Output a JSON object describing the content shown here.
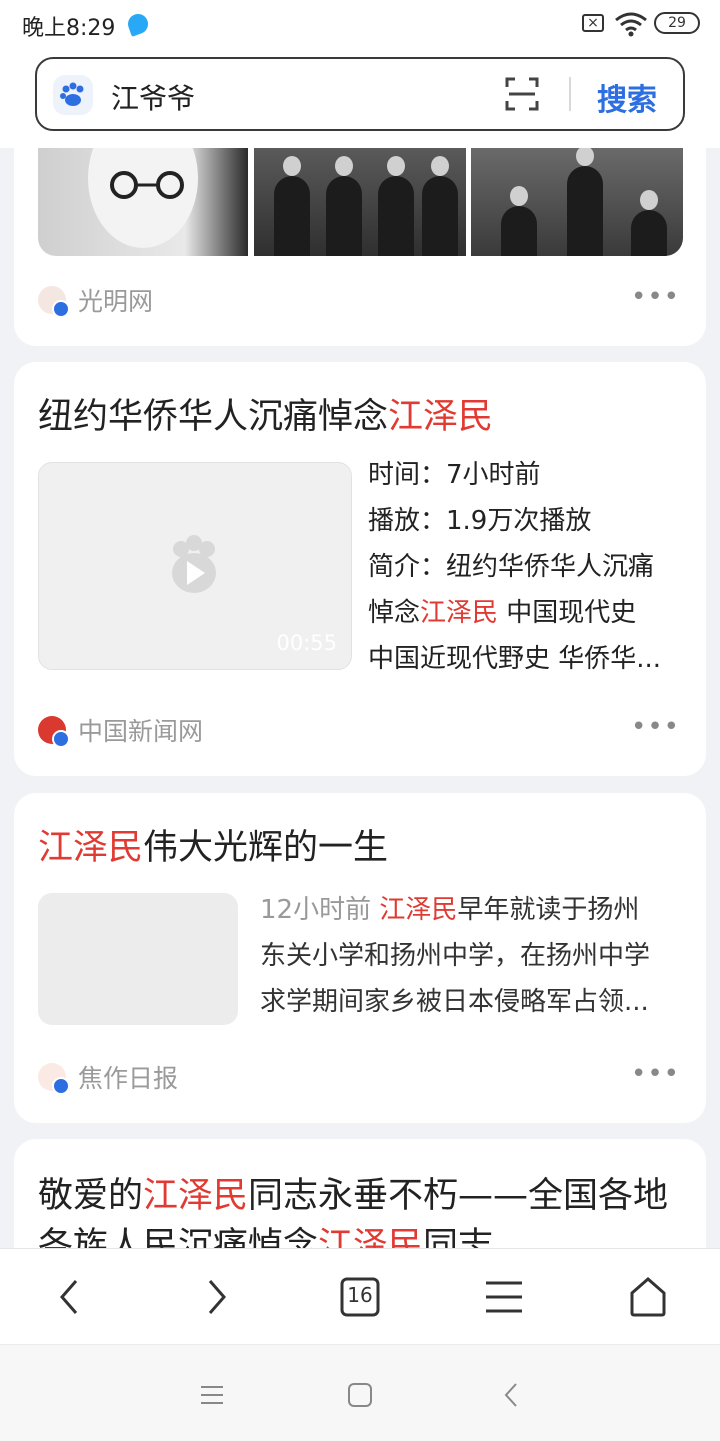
{
  "status_bar": {
    "time": "晚上8:29",
    "battery": "29"
  },
  "search": {
    "query": "江爷爷",
    "button_label": "搜索"
  },
  "cards": [
    {
      "source": "光明网"
    },
    {
      "title_prefix": "纽约华侨华人沉痛悼念",
      "title_highlight": "江泽民",
      "video_duration": "00:55",
      "time_line": "时间：7小时前",
      "plays_line": "播放：1.9万次播放",
      "intro_line1": "简介：纽约华侨华人沉痛",
      "intro_line2_prefix": "悼念",
      "intro_line2_highlight": "江泽民",
      "intro_line2_suffix": " 中国现代史",
      "intro_line3": "中国近现代野史 华侨华...",
      "source": "中国新闻网"
    },
    {
      "title_highlight": "江泽民",
      "title_suffix": "伟大光辉的一生",
      "snippet_time": "12小时前",
      "snippet_highlight": "江泽民",
      "snippet_line1_suffix": "早年就读于扬州",
      "snippet_line2": "东关小学和扬州中学，在扬州中学",
      "snippet_line3": "求学期间家乡被日本侵略军占领...",
      "source": "焦作日报"
    },
    {
      "line1_prefix": "敬爱的",
      "line1_highlight": "江泽民",
      "line1_suffix": "同志永垂不朽——全国各地",
      "line2_prefix": "各族人民沉痛悼念",
      "line2_highlight": "江泽民",
      "line2_suffix": "同志"
    }
  ],
  "bottom_nav": {
    "tabs_count": "16"
  },
  "colors": {
    "accent": "#2d6fe0",
    "highlight": "#e03a32",
    "source_grey": "#9a9a9a"
  }
}
